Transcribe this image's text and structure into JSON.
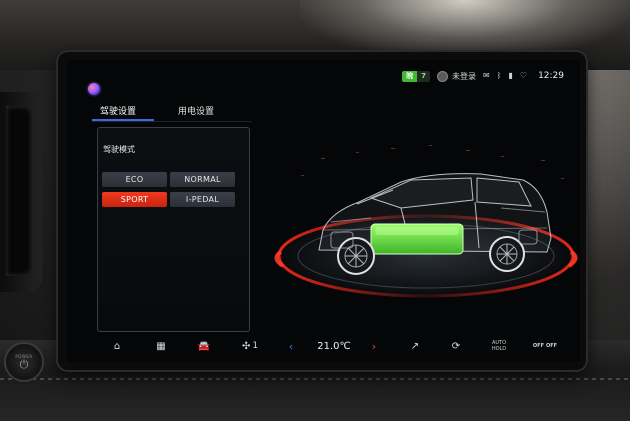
{
  "status_bar": {
    "plate_letter": "皖",
    "plate_number": "7",
    "user_label": "未登录",
    "time": "12:29",
    "icons": [
      "message-icon",
      "bluetooth-icon",
      "signal-icon",
      "wifi-icon"
    ]
  },
  "tabs": [
    {
      "label": "驾驶设置",
      "active": true
    },
    {
      "label": "用电设置",
      "active": false
    }
  ],
  "drive_mode": {
    "title": "驾驶模式",
    "options": [
      {
        "label": "ECO",
        "selected": false
      },
      {
        "label": "NORMAL",
        "selected": false
      },
      {
        "label": "SPORT",
        "selected": true
      },
      {
        "label": "I-PEDAL",
        "selected": false
      }
    ]
  },
  "dock": {
    "fan_level": "1",
    "temperature": "21.0℃",
    "auto_hold_line1": "AUTO",
    "auto_hold_line2": "HOLD",
    "off_label": "OFF",
    "off_label_2": "OFF",
    "power_label": "POWER"
  },
  "colors": {
    "accent_blue": "#3a6cd9",
    "sport_red": "#e5301a",
    "battery_green": "#6fe04a",
    "ring_red": "#ff2a1a"
  }
}
